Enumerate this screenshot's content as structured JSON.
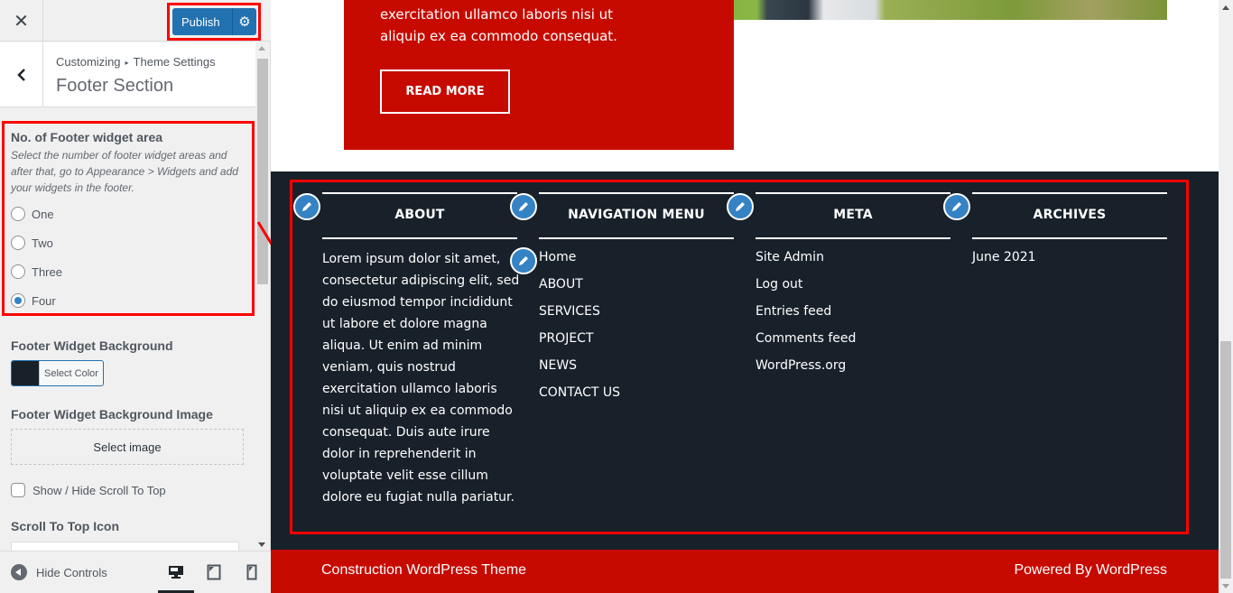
{
  "topbar": {
    "close_icon": "close-icon",
    "publish_label": "Publish",
    "settings_icon": "gear-icon"
  },
  "section_header": {
    "back_icon": "chevron-left-icon",
    "breadcrumb": [
      "Customizing",
      "Theme Settings"
    ],
    "title": "Footer Section"
  },
  "controls": {
    "widget_area": {
      "title": "No. of Footer widget area",
      "description": "Select the number of footer widget areas and after that, go to Appearance > Widgets and add your widgets in the footer.",
      "options": [
        "One",
        "Two",
        "Three",
        "Four"
      ],
      "selected": "Four"
    },
    "widget_background": {
      "title": "Footer Widget Background",
      "button_label": "Select Color",
      "color": "#18212a"
    },
    "widget_background_image": {
      "title": "Footer Widget Background Image",
      "button_label": "Select image"
    },
    "scroll_to_top": {
      "label": "Show / Hide Scroll To Top",
      "checked": false
    },
    "scroll_to_top_icon": {
      "title": "Scroll To Top Icon",
      "value": ""
    }
  },
  "panel_footer": {
    "hide_controls_label": "Hide Controls",
    "devices": [
      "desktop",
      "tablet",
      "mobile"
    ],
    "active_device": "desktop"
  },
  "preview": {
    "card": {
      "text": "exercitation ullamco laboris nisi ut aliquip ex ea commodo consequat.",
      "button_label": "READ MORE"
    },
    "footer_widgets": [
      {
        "title": "ABOUT",
        "text": "Lorem ipsum dolor sit amet, consectetur adipiscing elit, sed do eiusmod tempor incididunt ut labore et dolore magna aliqua. Ut enim ad minim veniam, quis nostrud exercitation ullamco laboris nisi ut aliquip ex ea commodo consequat. Duis aute irure dolor in reprehenderit in voluptate velit esse cillum dolore eu fugiat nulla pariatur."
      },
      {
        "title": "NAVIGATION MENU",
        "links": [
          "Home",
          "ABOUT",
          "SERVICES",
          "PROJECT",
          "NEWS",
          "CONTACT US"
        ]
      },
      {
        "title": "META",
        "links": [
          "Site Admin",
          "Log out",
          "Entries feed",
          "Comments feed",
          "WordPress.org"
        ]
      },
      {
        "title": "ARCHIVES",
        "links": [
          "June 2021"
        ]
      }
    ],
    "copyright_left": "Construction WordPress Theme",
    "copyright_right": "Powered By WordPress"
  },
  "colors": {
    "accent_red": "#c70a00",
    "footer_bg": "#18212a",
    "wp_blue": "#2271b1",
    "highlight": "#ff0000"
  }
}
